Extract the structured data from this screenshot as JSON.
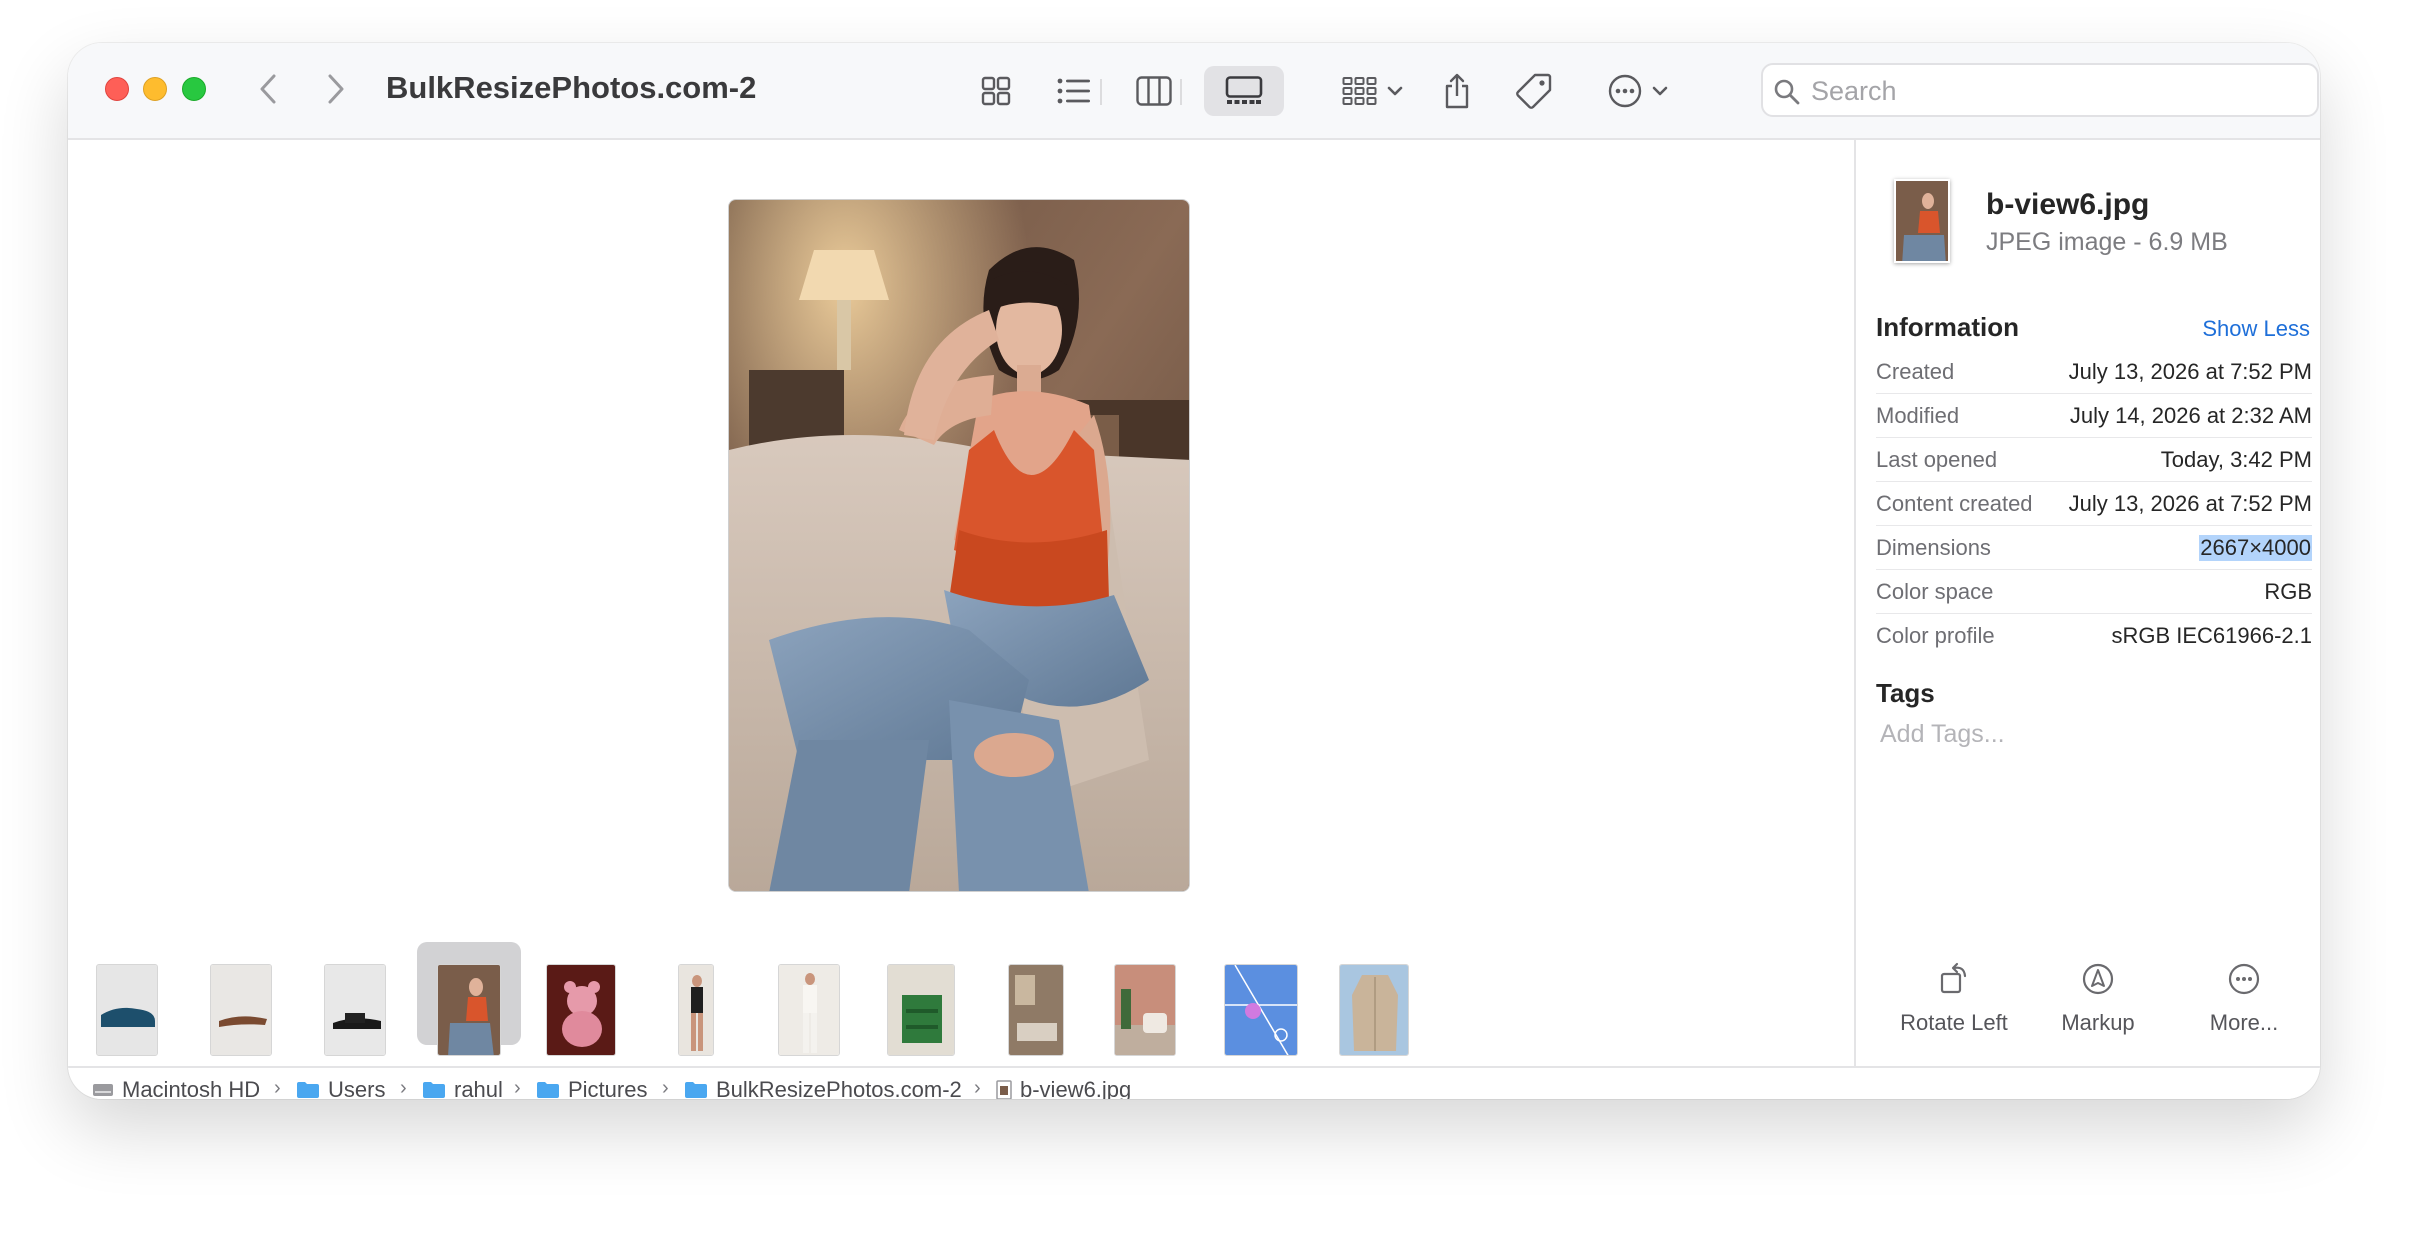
{
  "window": {
    "title": "BulkResizePhotos.com-2"
  },
  "toolbar": {
    "views": [
      "grid-view",
      "list-view",
      "column-view",
      "gallery-view"
    ],
    "selected_view": "gallery-view",
    "search": {
      "placeholder": "Search",
      "value": ""
    }
  },
  "preview": {
    "file": "b-view6.jpg"
  },
  "filmstrip": {
    "items": [
      {
        "subject": "blue shoe"
      },
      {
        "subject": "sandal"
      },
      {
        "subject": "black sandal"
      },
      {
        "subject": "woman on sofa",
        "selected": true
      },
      {
        "subject": "pink teddy bear"
      },
      {
        "subject": "woman standing"
      },
      {
        "subject": "woman in white"
      },
      {
        "subject": "green cabinet"
      },
      {
        "subject": "living room"
      },
      {
        "subject": "room with chair"
      },
      {
        "subject": "pickleball court"
      },
      {
        "subject": "beige jacket"
      }
    ]
  },
  "inspector": {
    "file_name": "b-view6.jpg",
    "file_kind": "JPEG image - 6.9 MB",
    "information_heading": "Information",
    "show_less": "Show Less",
    "info": [
      {
        "key": "Created",
        "value": "July 13, 2026 at 7:52 PM"
      },
      {
        "key": "Modified",
        "value": "July 14, 2026 at 2:32 AM"
      },
      {
        "key": "Last opened",
        "value": "Today, 3:42 PM"
      },
      {
        "key": "Content created",
        "value": "July 13, 2026 at 7:52 PM"
      },
      {
        "key": "Dimensions",
        "value": "2667×4000",
        "highlighted": true
      },
      {
        "key": "Color space",
        "value": "RGB"
      },
      {
        "key": "Color profile",
        "value": "sRGB IEC61966-2.1"
      }
    ],
    "tags_heading": "Tags",
    "add_tags_placeholder": "Add Tags...",
    "actions": [
      {
        "label": "Rotate Left",
        "icon": "rotate-left-icon"
      },
      {
        "label": "Markup",
        "icon": "markup-icon"
      },
      {
        "label": "More...",
        "icon": "more-icon"
      }
    ]
  },
  "pathbar": {
    "crumbs": [
      "Macintosh HD",
      "Users",
      "rahul",
      "Pictures",
      "BulkResizePhotos.com-2",
      "b-view6.jpg"
    ]
  },
  "colors": {
    "accent": "#1e6fd9",
    "selection": "#b3d4fb",
    "close": "#fe5f57",
    "minimize": "#febc2e",
    "zoom": "#28c840"
  }
}
